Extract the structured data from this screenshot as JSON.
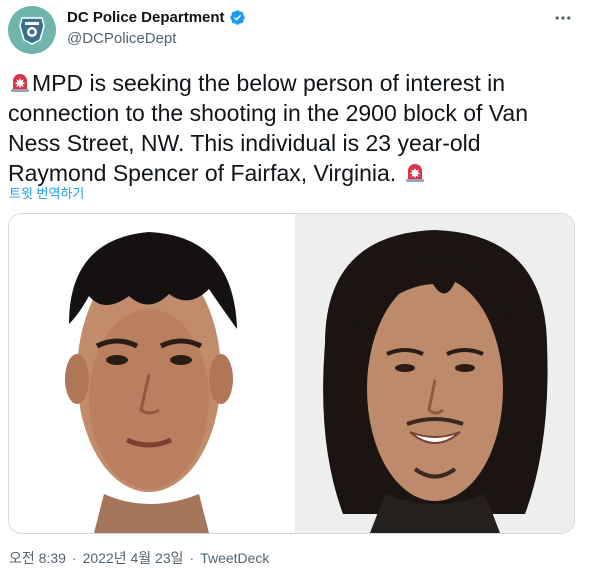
{
  "user": {
    "display_name": "DC Police Department",
    "handle": "@DCPoliceDept",
    "verified": true,
    "avatar_icon": "police-badge-icon"
  },
  "tweet": {
    "text_part1": "MPD is seeking the below person of interest in connection to the shooting in the 2900 block of Van Ness Street, NW. This individual is 23 year-old Raymond Spencer of Fairfax, Virginia. ",
    "emoji_icon": "police-siren-icon",
    "translate_label": "트윗 번역하기"
  },
  "media": {
    "photos": [
      {
        "icon": "person-photo-short-hair"
      },
      {
        "icon": "person-photo-long-hair"
      }
    ]
  },
  "meta": {
    "time": "오전 8:39",
    "separator": "·",
    "date": "2022년 4월 23일",
    "separator2": "·",
    "via": "TweetDeck"
  },
  "colors": {
    "accent": "#1d9bf0",
    "text": "#0f1419",
    "muted": "#536471",
    "border": "#cfd9de",
    "avatar_bg": "#6fb5ae",
    "siren_red": "#d8334a"
  }
}
